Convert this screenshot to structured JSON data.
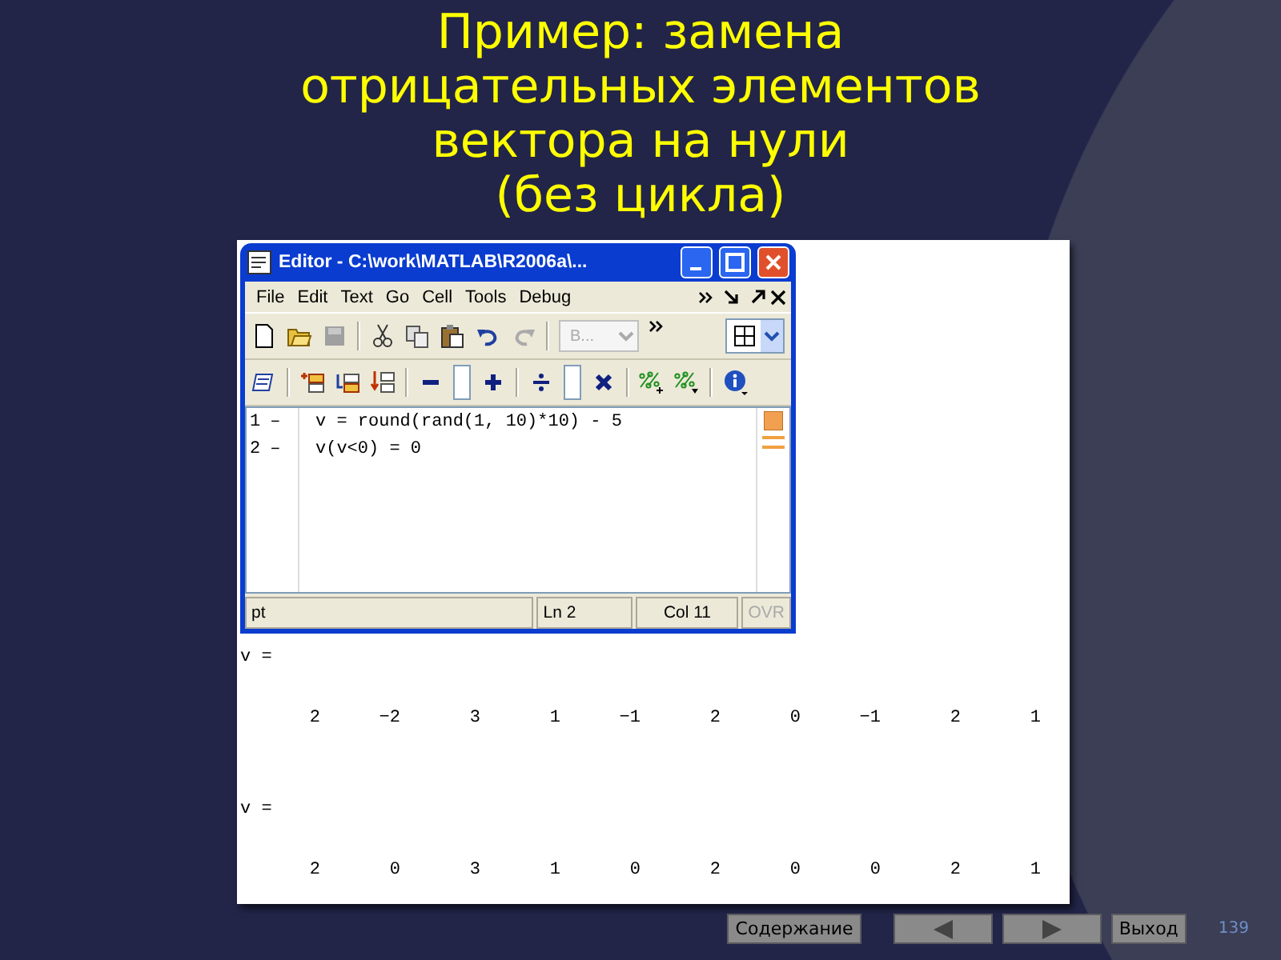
{
  "slide_title": [
    "Пример: замена",
    "отрицательных элементов",
    "вектора на нули",
    "(без цикла)"
  ],
  "editor": {
    "title": "Editor - C:\\work\\MATLAB\\R2006a\\...",
    "menu": [
      "File",
      "Edit",
      "Text",
      "Go",
      "Cell",
      "Tools",
      "Debug"
    ],
    "toolbar_1": [
      {
        "kind": "new",
        "disabled": false
      },
      {
        "kind": "open",
        "disabled": false
      },
      {
        "kind": "save",
        "disabled": true
      },
      {
        "kind": "sep"
      },
      {
        "kind": "cut",
        "disabled": false
      },
      {
        "kind": "copy",
        "disabled": false
      },
      {
        "kind": "paste",
        "disabled": false
      },
      {
        "kind": "undo",
        "disabled": false
      },
      {
        "kind": "redo",
        "disabled": true
      },
      {
        "kind": "sep"
      },
      {
        "kind": "combo",
        "label": "B...",
        "disabled": true
      },
      {
        "kind": "more"
      },
      {
        "kind": "layout"
      }
    ],
    "toolbar_2": [
      {
        "kind": "cell-edit"
      },
      {
        "kind": "sep"
      },
      {
        "kind": "insert-above"
      },
      {
        "kind": "insert-below"
      },
      {
        "kind": "insert-down"
      },
      {
        "kind": "sep"
      },
      {
        "kind": "minus"
      },
      {
        "kind": "field"
      },
      {
        "kind": "plus"
      },
      {
        "kind": "sep"
      },
      {
        "kind": "divide"
      },
      {
        "kind": "field"
      },
      {
        "kind": "times"
      },
      {
        "kind": "sep"
      },
      {
        "kind": "percent-plus"
      },
      {
        "kind": "percent-down"
      },
      {
        "kind": "sep"
      },
      {
        "kind": "info"
      }
    ],
    "code_lines": [
      {
        "number": "1",
        "marker": "–",
        "text": "v = round(rand(1, 10)*10) - 5"
      },
      {
        "number": "2",
        "marker": "–",
        "text": "v(v<0) = 0"
      }
    ],
    "status": {
      "message": "pt",
      "line": "Ln  2",
      "column": "Col  11",
      "ovr": {
        "label": "OVR",
        "disabled": true
      }
    }
  },
  "output": [
    {
      "kind": "variable",
      "text": "v ="
    },
    {
      "kind": "values",
      "values": [
        "2",
        "−2",
        "3",
        "1",
        "−1",
        "2",
        "0",
        "−1",
        "2",
        "1"
      ]
    },
    {
      "kind": "variable",
      "text": "v ="
    },
    {
      "kind": "values",
      "values": [
        "2",
        "0",
        "3",
        "1",
        "0",
        "2",
        "0",
        "0",
        "2",
        "1"
      ]
    }
  ],
  "nav": {
    "buttons": [
      {
        "kind": "text",
        "label": "Содержание"
      },
      {
        "kind": "prev"
      },
      {
        "kind": "next"
      },
      {
        "kind": "text",
        "label": "Выход"
      }
    ],
    "page_number": "139"
  }
}
